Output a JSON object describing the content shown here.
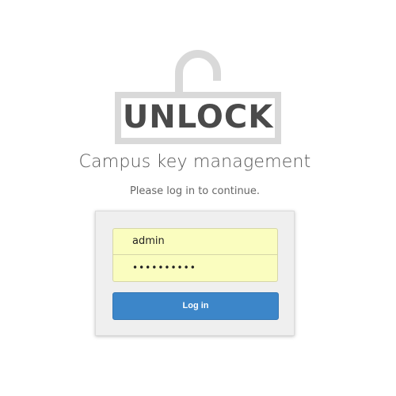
{
  "logo": {
    "text": "UNLOCK",
    "icon": "padlock-open-icon",
    "color": "#4a4a4a",
    "icon_color": "#d9d9d9"
  },
  "app_title": "Campus key management",
  "subtitle": "Please log in to continue.",
  "login_form": {
    "username_value": "admin",
    "password_value": "••••••••••",
    "field_bg": "#fafdbf",
    "button_label": "Log in",
    "button_color": "#3c86c9"
  }
}
